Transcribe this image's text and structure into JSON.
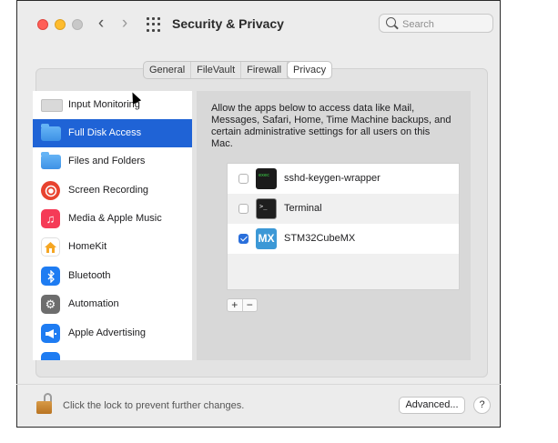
{
  "window": {
    "title": "Security & Privacy",
    "search_placeholder": "Search"
  },
  "tabs": [
    {
      "label": "General",
      "active": false
    },
    {
      "label": "FileVault",
      "active": false
    },
    {
      "label": "Firewall",
      "active": false
    },
    {
      "label": "Privacy",
      "active": true
    }
  ],
  "sidebar": {
    "selected_index": 1,
    "items": [
      {
        "label": "Input Monitoring",
        "icon": "keyboard-icon"
      },
      {
        "label": "Full Disk Access",
        "icon": "folder-icon"
      },
      {
        "label": "Files and Folders",
        "icon": "folder-icon"
      },
      {
        "label": "Screen Recording",
        "icon": "screen-recording-icon"
      },
      {
        "label": "Media & Apple Music",
        "icon": "music-icon"
      },
      {
        "label": "HomeKit",
        "icon": "home-icon"
      },
      {
        "label": "Bluetooth",
        "icon": "bluetooth-icon"
      },
      {
        "label": "Automation",
        "icon": "gear-icon"
      },
      {
        "label": "Apple Advertising",
        "icon": "megaphone-icon"
      }
    ]
  },
  "content": {
    "description": "Allow the apps below to access data like Mail, Messages, Safari, Home, Time Machine backups, and certain administrative settings for all users on this Mac.",
    "apps": [
      {
        "name": "sshd-keygen-wrapper",
        "checked": false,
        "icon": "exec-icon"
      },
      {
        "name": "Terminal",
        "checked": false,
        "icon": "terminal-icon"
      },
      {
        "name": "STM32CubeMX",
        "checked": true,
        "icon": "mx-icon",
        "icon_text": "MX"
      }
    ],
    "add_label": "+",
    "remove_label": "−"
  },
  "footer": {
    "lock_text": "Click the lock to prevent further changes.",
    "advanced_label": "Advanced...",
    "help_label": "?"
  },
  "colors": {
    "selection": "#1f63d6",
    "checkbox_checked": "#2a6fdb",
    "mx_icon_bg": "#3c98d6"
  }
}
